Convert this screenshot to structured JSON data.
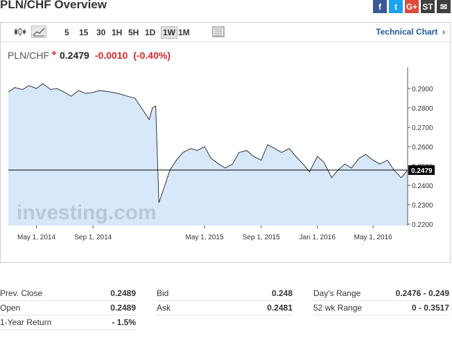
{
  "page": {
    "title": "PLN/CHF Overview"
  },
  "social": [
    {
      "name": "facebook-icon",
      "glyph": "f",
      "color": "#3b5998"
    },
    {
      "name": "twitter-icon",
      "glyph": "t",
      "color": "#1da1f2"
    },
    {
      "name": "google-plus-icon",
      "glyph": "G+",
      "color": "#dd4b39"
    },
    {
      "name": "stocktwits-icon",
      "glyph": "ST",
      "color": "#404040"
    },
    {
      "name": "email-icon",
      "glyph": "✉",
      "color": "#404040"
    }
  ],
  "toolbar": {
    "timeframes": [
      "5",
      "15",
      "30",
      "1H",
      "5H",
      "1D",
      "1W",
      "1M"
    ],
    "active_timeframe": "1W",
    "technical_chart_label": "Technical Chart"
  },
  "quote": {
    "symbol": "PLN/CHF",
    "last": "0.2479",
    "change": "-0.0010",
    "change_pct": "(-0.40%)",
    "direction": "down"
  },
  "colors": {
    "down": "#d9262c",
    "link": "#1e5a9c",
    "area": "#d6e8fa",
    "line": "#333333"
  },
  "chart_data": {
    "type": "area",
    "watermark": "investing.com",
    "x_ticks": [
      "May 1, 2014",
      "Sep 1, 2014",
      "May 1, 2015",
      "Sep 1, 2015",
      "Jan 1, 2016",
      "May 1, 2016"
    ],
    "y_ticks": [
      "0.2900",
      "0.2800",
      "0.2700",
      "0.2600",
      "0.2500",
      "0.2400",
      "0.2300",
      "0.2200"
    ],
    "ylim": [
      0.22,
      0.29
    ],
    "current_value": "0.2479",
    "series": [
      {
        "x": [
          "2014-03-01",
          "2014-03-15",
          "2014-04-01",
          "2014-04-15",
          "2014-05-01",
          "2014-05-15",
          "2014-06-01",
          "2014-06-15",
          "2014-07-01",
          "2014-07-15",
          "2014-08-01",
          "2014-08-15",
          "2014-09-01",
          "2014-09-15",
          "2014-10-01",
          "2014-10-15",
          "2014-11-01",
          "2014-11-15",
          "2014-12-01",
          "2014-12-15",
          "2015-01-01",
          "2015-01-08",
          "2015-01-15",
          "2015-01-22",
          "2015-02-01",
          "2015-02-15",
          "2015-03-01",
          "2015-03-15",
          "2015-04-01",
          "2015-04-15",
          "2015-05-01",
          "2015-05-15",
          "2015-06-01",
          "2015-06-15",
          "2015-07-01",
          "2015-07-15",
          "2015-08-01",
          "2015-08-15",
          "2015-09-01",
          "2015-09-15",
          "2015-10-01",
          "2015-10-15",
          "2015-11-01",
          "2015-11-15",
          "2015-12-01",
          "2015-12-15",
          "2016-01-01",
          "2016-01-15",
          "2016-02-01",
          "2016-02-15",
          "2016-03-01",
          "2016-03-15",
          "2016-04-01",
          "2016-04-15",
          "2016-05-01",
          "2016-05-15",
          "2016-06-01",
          "2016-06-15",
          "2016-07-01",
          "2016-07-15"
        ],
        "y": [
          0.2882,
          0.2905,
          0.2895,
          0.2915,
          0.29,
          0.2925,
          0.2895,
          0.29,
          0.288,
          0.286,
          0.289,
          0.2875,
          0.288,
          0.289,
          0.2885,
          0.288,
          0.287,
          0.286,
          0.285,
          0.28,
          0.274,
          0.28,
          0.281,
          0.231,
          0.238,
          0.248,
          0.253,
          0.257,
          0.259,
          0.258,
          0.26,
          0.254,
          0.251,
          0.249,
          0.251,
          0.257,
          0.258,
          0.255,
          0.253,
          0.261,
          0.259,
          0.257,
          0.259,
          0.255,
          0.251,
          0.247,
          0.255,
          0.252,
          0.244,
          0.248,
          0.251,
          0.249,
          0.254,
          0.256,
          0.253,
          0.251,
          0.253,
          0.248,
          0.244,
          0.2479
        ]
      }
    ]
  },
  "stats": [
    [
      {
        "label": "Prev. Close",
        "value": "0.2489"
      },
      {
        "label": "Bid",
        "value": "0.248"
      },
      {
        "label": "Day's Range",
        "value": "0.2476 - 0.249"
      }
    ],
    [
      {
        "label": "Open",
        "value": "0.2489"
      },
      {
        "label": "Ask",
        "value": "0.2481"
      },
      {
        "label": "52 wk Range",
        "value": "0 - 0.3517"
      }
    ],
    [
      {
        "label": "1-Year Return",
        "value": "- 1.5%"
      }
    ]
  ]
}
